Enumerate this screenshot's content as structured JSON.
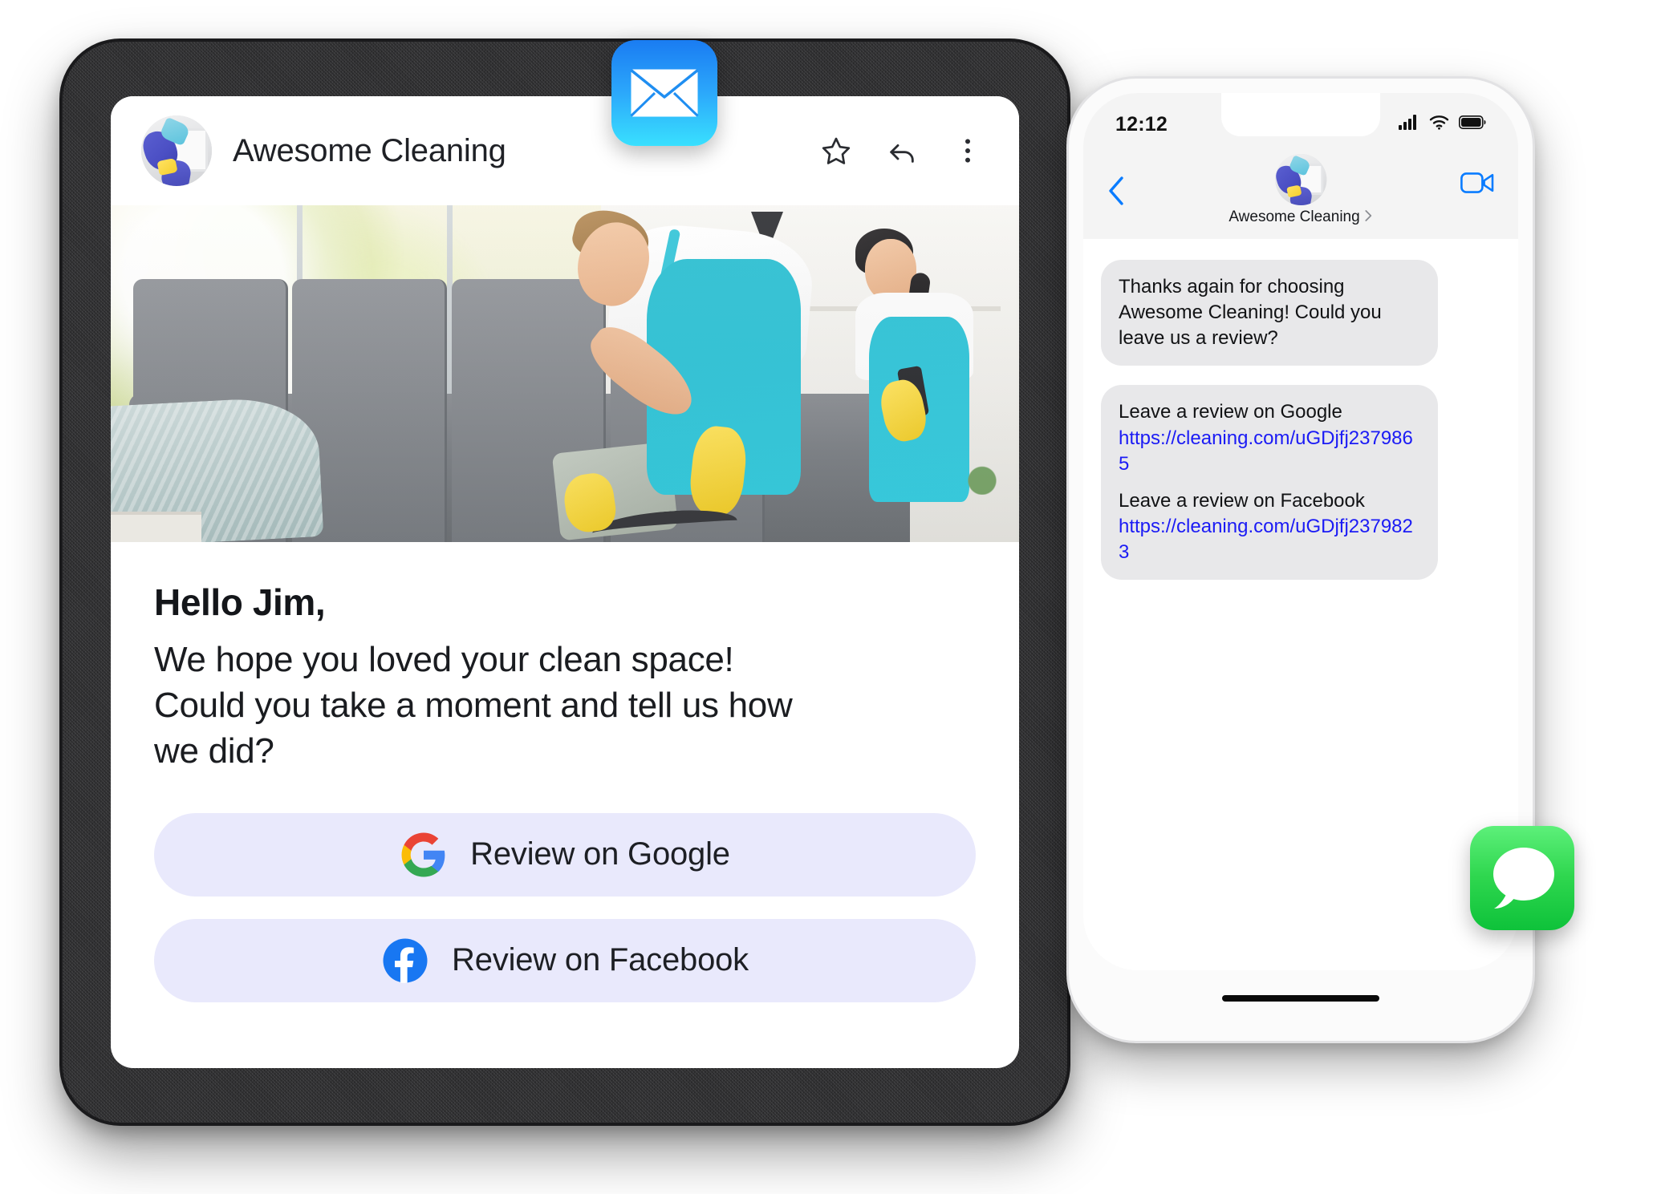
{
  "email": {
    "sender_name": "Awesome Cleaning",
    "header_icons": {
      "star": "star-icon",
      "reply": "reply-icon",
      "more": "more-vertical-icon"
    },
    "avatar_alt": "awesome-cleaning-logo",
    "hero_alt": "cleaners-vacuuming-living-room",
    "greeting": "Hello Jim,",
    "body_line_1": "We hope you loved your clean space!",
    "body_line_2": "Could you take a moment and tell us how",
    "body_line_3": "we did?",
    "cta": {
      "google_label": "Review on Google",
      "facebook_label": "Review on Facebook",
      "button_bg": "#e9e9fc"
    }
  },
  "phone": {
    "status": {
      "time": "12:12",
      "cellular": "signal-bars-icon",
      "wifi": "wifi-icon",
      "battery": "battery-icon"
    },
    "navbar": {
      "back": "back-chevron-icon",
      "contact_name": "Awesome Cleaning",
      "contact_chevron": "chevron-right-icon",
      "facetime": "facetime-video-icon"
    },
    "messages": [
      {
        "type": "text",
        "text": "Thanks again for choosing Awesome Cleaning! Could you leave us a review?"
      },
      {
        "type": "links",
        "items": [
          {
            "label": "Leave a review on Google",
            "url": "https://cleaning.com/uGDjfj2379865"
          },
          {
            "label": "Leave a review on Facebook",
            "url": "https://cleaning.com/uGDjfj2379823"
          }
        ]
      }
    ],
    "home_indicator": "home-indicator"
  },
  "app_icons": {
    "mail": "apple-mail-icon",
    "messages": "apple-messages-icon"
  },
  "colors": {
    "link_blue": "#1b1bf5",
    "ios_blue": "#0a7cff",
    "bubble_gray": "#e8e8ea",
    "cta_lavender": "#e9e9fc",
    "google_blue": "#4285f4",
    "google_red": "#ea4335",
    "google_yellow": "#fbbc05",
    "google_green": "#34a853",
    "facebook_blue": "#1877f2",
    "apron_teal": "#2ec2d6",
    "glove_yellow": "#f5d02f"
  }
}
